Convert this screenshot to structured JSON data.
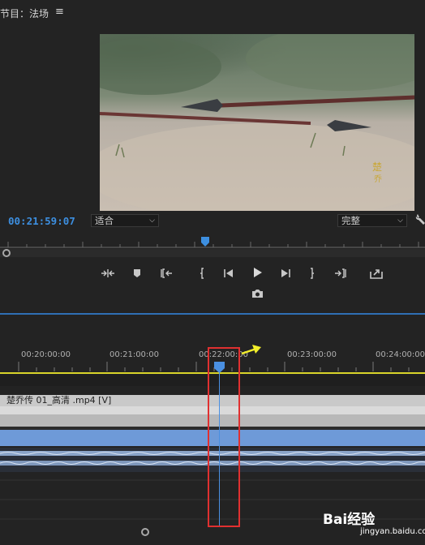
{
  "monitor": {
    "title": "节目：法场",
    "menu_glyph": "≡",
    "timecode": "00:21:59:07",
    "fit_dropdown": "适合",
    "quality_dropdown": "完整",
    "transport_icons": [
      "mark-in-out-icon",
      "add-marker-icon",
      "go-to-in-icon",
      "mark-in-icon",
      "step-back-icon",
      "play-icon",
      "step-forward-icon",
      "mark-out-icon",
      "go-to-out-icon",
      "export-frame-icon",
      "camera-icon"
    ]
  },
  "timeline": {
    "timecodes": [
      "00:20:00:00",
      "00:21:00:00",
      "00:22:00:00",
      "00:23:00:00",
      "00:24:00:00"
    ],
    "clip_label": "楚乔传  01_高清 .mp4 [V]"
  },
  "watermark": {
    "logo_text": "Bai经验",
    "url": "jingyan.baidu.com"
  },
  "colors": {
    "accent": "#3d8fe0",
    "workarea": "#d9d42a",
    "annotation": "#e03030",
    "audio_track": "#6e9ad8"
  }
}
